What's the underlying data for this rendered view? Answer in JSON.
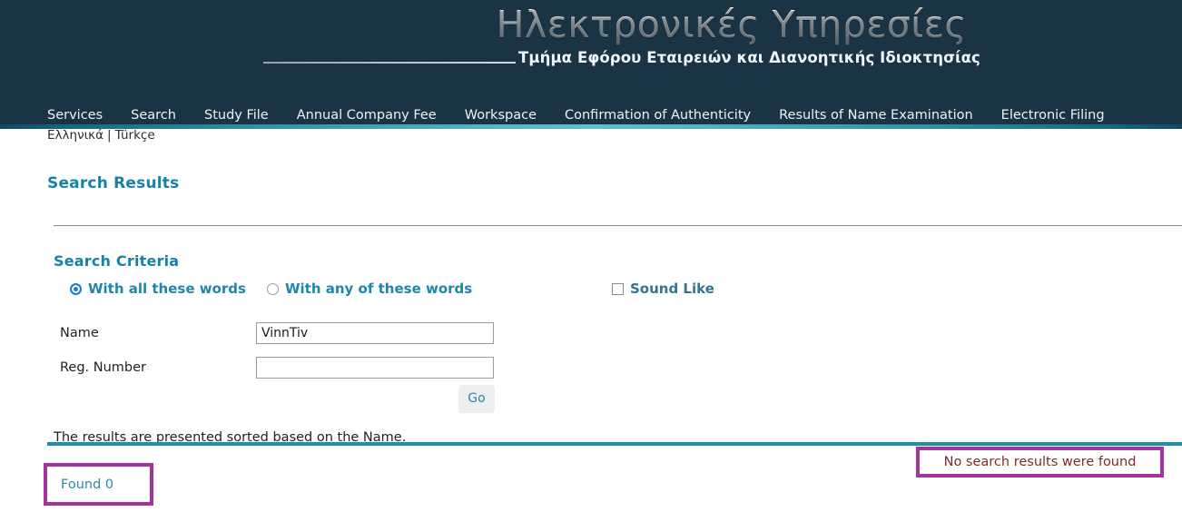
{
  "header": {
    "brand_title": "Ηλεκτρονικές Υπηρεσίες",
    "brand_subtitle": "Τμήμα Εφόρου Εταιρειών και Διανοητικής Ιδιοκτησίας",
    "background_color": "#1b3445",
    "accent_color": "#5bc0d3"
  },
  "nav": {
    "items": [
      {
        "label": "Services"
      },
      {
        "label": "Search"
      },
      {
        "label": "Study File"
      },
      {
        "label": "Annual Company Fee"
      },
      {
        "label": "Workspace"
      },
      {
        "label": "Confirmation of Authenticity"
      },
      {
        "label": "Results of Name Examination"
      },
      {
        "label": "Electronic Filing"
      }
    ]
  },
  "language_bar": {
    "greek": "Ελληνικά",
    "separator": "|",
    "turkish": "Türkçe"
  },
  "page": {
    "title": "Search Results",
    "section_title": "Search Criteria",
    "title_color": "#1782a8"
  },
  "search_criteria": {
    "options": [
      {
        "label": "With all these words",
        "type": "radio",
        "selected": true
      },
      {
        "label": "With any of these words",
        "type": "radio",
        "selected": false
      },
      {
        "label": "Sound Like",
        "type": "checkbox",
        "selected": false
      }
    ],
    "fields": [
      {
        "label": "Name",
        "value": "VinnTiv",
        "placeholder": ""
      },
      {
        "label": "Reg. Number",
        "value": "",
        "placeholder": ""
      }
    ],
    "submit_label": "Go"
  },
  "results": {
    "sort_note": "The results are presented sorted based on the Name.",
    "found_label": "Found",
    "found_count": "0",
    "found_text": "Found  0",
    "empty_message": "No search results were found",
    "highlight_color": "#a5339c",
    "empty_message_color": "#7a2b2b",
    "rule_color": "#1a8fa8"
  }
}
